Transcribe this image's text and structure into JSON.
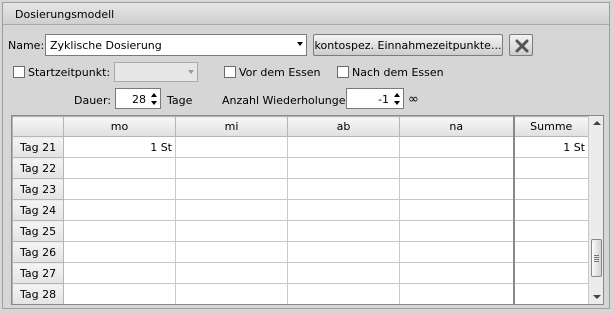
{
  "panel": {
    "title": "Dosierungsmodell"
  },
  "name_row": {
    "label": "Name:",
    "value": "Zyklische Dosierung",
    "button_label": "kontospez. Einnahmezeitpunkte..."
  },
  "options_row": {
    "start_label": "Startzeitpunkt:",
    "start_value": "",
    "before_meal_label": "Vor dem Essen",
    "after_meal_label": "Nach dem Essen"
  },
  "duration_row": {
    "duration_label": "Dauer:",
    "duration_value": "28",
    "duration_unit": "Tage",
    "repeat_label": "Anzahl Wiederholungen:",
    "repeat_value": "-1",
    "repeat_symbol": "∞"
  },
  "grid": {
    "columns": [
      "",
      "mo",
      "mi",
      "ab",
      "na",
      "Summe"
    ],
    "rows": [
      {
        "day": "Tag 21",
        "mo": "1 St",
        "mi": "",
        "ab": "",
        "na": "",
        "sum": "1 St"
      },
      {
        "day": "Tag 22",
        "mo": "",
        "mi": "",
        "ab": "",
        "na": "",
        "sum": ""
      },
      {
        "day": "Tag 23",
        "mo": "",
        "mi": "",
        "ab": "",
        "na": "",
        "sum": ""
      },
      {
        "day": "Tag 24",
        "mo": "",
        "mi": "",
        "ab": "",
        "na": "",
        "sum": ""
      },
      {
        "day": "Tag 25",
        "mo": "",
        "mi": "",
        "ab": "",
        "na": "",
        "sum": ""
      },
      {
        "day": "Tag 26",
        "mo": "",
        "mi": "",
        "ab": "",
        "na": "",
        "sum": ""
      },
      {
        "day": "Tag 27",
        "mo": "",
        "mi": "",
        "ab": "",
        "na": "",
        "sum": ""
      },
      {
        "day": "Tag 28",
        "mo": "",
        "mi": "",
        "ab": "",
        "na": "",
        "sum": ""
      }
    ]
  }
}
